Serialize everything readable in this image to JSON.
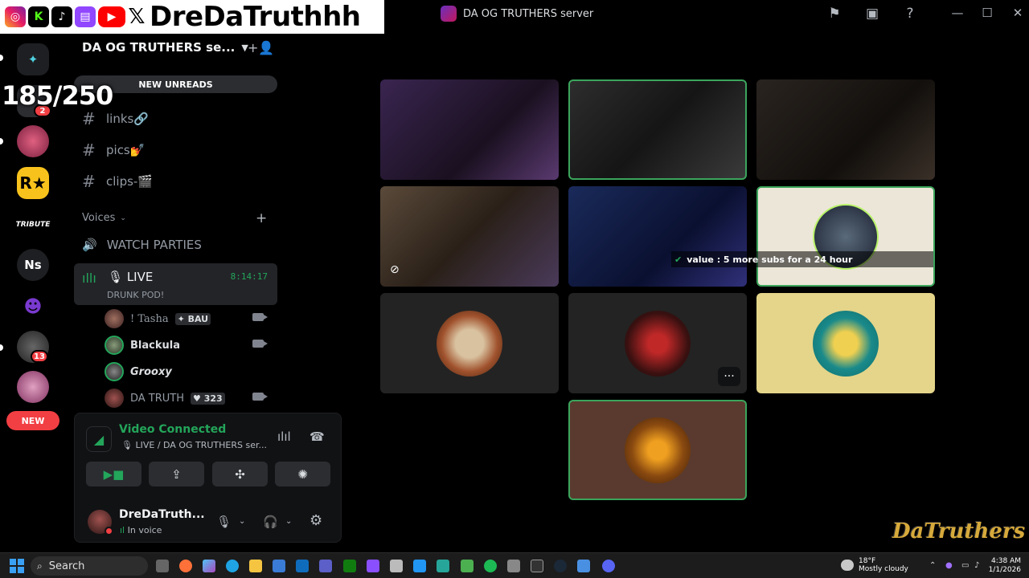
{
  "overlay": {
    "handle": "DreDaTruthhh",
    "socials": [
      "instagram-icon",
      "kick-icon",
      "tiktok-icon",
      "twitch-icon",
      "youtube-icon",
      "x-icon"
    ]
  },
  "window": {
    "title": "DA OG TRUTHERS server",
    "controls": {
      "minimize": "—",
      "maximize": "☐",
      "close": "✕"
    }
  },
  "viewer_count": "185/250",
  "rail": {
    "ns_label": "Ns",
    "tribute_label": "TRIBUTE",
    "badge_1": "2",
    "badge_2": "13",
    "new_label": "NEW"
  },
  "sidebar": {
    "server_name": "DA OG TRUTHERS se...",
    "new_unreads": "NEW UNREADS",
    "text_channels": [
      {
        "name": "links🔗"
      },
      {
        "name": "pics💅"
      },
      {
        "name": "clips-🎬"
      }
    ],
    "voices_label": "Voices",
    "watch_parties": "WATCH PARTIES",
    "live": {
      "name": "LIVE",
      "timer": "8:14:17",
      "status": "DRUNK POD!"
    },
    "voice_users": [
      {
        "name": "! Tasha",
        "tag": "BAU"
      },
      {
        "name": "Blackula",
        "tag": ""
      },
      {
        "name": "Grooxy",
        "tag": ""
      },
      {
        "name": "DA TRUTH",
        "tag": "323"
      }
    ]
  },
  "voice_panel": {
    "status": "Video Connected",
    "channel": "LIVE / DA OG TRUTHERS ser..."
  },
  "user": {
    "name": "DreDaTruth...",
    "sub": "In voice"
  },
  "stage": {
    "value_overlay": "value : 5 more subs for a 24 hour",
    "more_label": "···"
  },
  "watermark": "DaTruthers",
  "taskbar": {
    "search_label": "Search",
    "weather_temp": "18°F",
    "weather_desc": "Mostly cloudy",
    "time": "4:38 AM",
    "date": "1/1/2026"
  },
  "colors": {
    "accent_green": "#23a55a",
    "speaking_border": "#3ba55c",
    "badge_red": "#f23f43"
  }
}
